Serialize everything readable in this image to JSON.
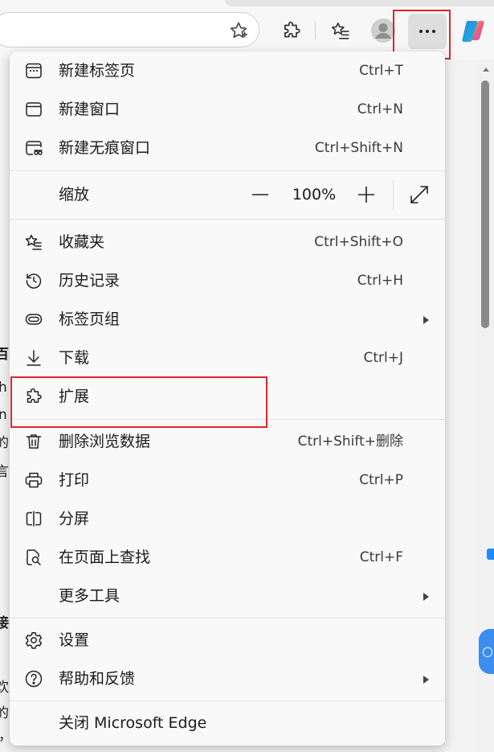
{
  "toolbar": {
    "buttons": {
      "favorite_star": "favorite-star-icon",
      "extensions": "extensions-puzzle-icon",
      "favorites": "favorites-icon",
      "profile": "profile-avatar-icon",
      "more": "more-dots-icon",
      "copilot": "copilot-icon"
    }
  },
  "background_fragments": [
    "百",
    "h",
    "n",
    "的",
    "言",
    "接",
    "欢",
    "的",
    "，"
  ],
  "menu": {
    "items": [
      {
        "label": "新建标签页",
        "shortcut": "Ctrl+T",
        "icon": "new-tab-icon"
      },
      {
        "label": "新建窗口",
        "shortcut": "Ctrl+N",
        "icon": "new-window-icon"
      },
      {
        "label": "新建无痕窗口",
        "shortcut": "Ctrl+Shift+N",
        "icon": "inprivate-window-icon"
      }
    ],
    "zoom": {
      "label": "缩放",
      "value": "100%"
    },
    "items2": [
      {
        "label": "收藏夹",
        "shortcut": "Ctrl+Shift+O",
        "icon": "favorites-star-icon"
      },
      {
        "label": "历史记录",
        "shortcut": "Ctrl+H",
        "icon": "history-icon"
      },
      {
        "label": "标签页组",
        "shortcut": "",
        "icon": "tab-groups-icon",
        "submenu": true
      },
      {
        "label": "下载",
        "shortcut": "Ctrl+J",
        "icon": "download-icon"
      },
      {
        "label": "扩展",
        "shortcut": "",
        "icon": "extensions-icon"
      },
      {
        "label": "删除浏览数据",
        "shortcut": "Ctrl+Shift+删除",
        "icon": "trash-icon"
      },
      {
        "label": "打印",
        "shortcut": "Ctrl+P",
        "icon": "print-icon"
      },
      {
        "label": "分屏",
        "shortcut": "",
        "icon": "split-screen-icon"
      },
      {
        "label": "在页面上查找",
        "shortcut": "Ctrl+F",
        "icon": "find-on-page-icon"
      },
      {
        "label": "更多工具",
        "shortcut": "",
        "icon": "",
        "submenu": true
      }
    ],
    "items3": [
      {
        "label": "设置",
        "shortcut": "",
        "icon": "settings-gear-icon"
      },
      {
        "label": "帮助和反馈",
        "shortcut": "",
        "icon": "help-icon",
        "submenu": true
      }
    ],
    "close": {
      "label": "关闭 Microsoft Edge"
    }
  },
  "colors": {
    "highlight_red": "#e0262c",
    "menu_bg": "#f9f9f9",
    "accent_blue": "#3b8df0"
  }
}
